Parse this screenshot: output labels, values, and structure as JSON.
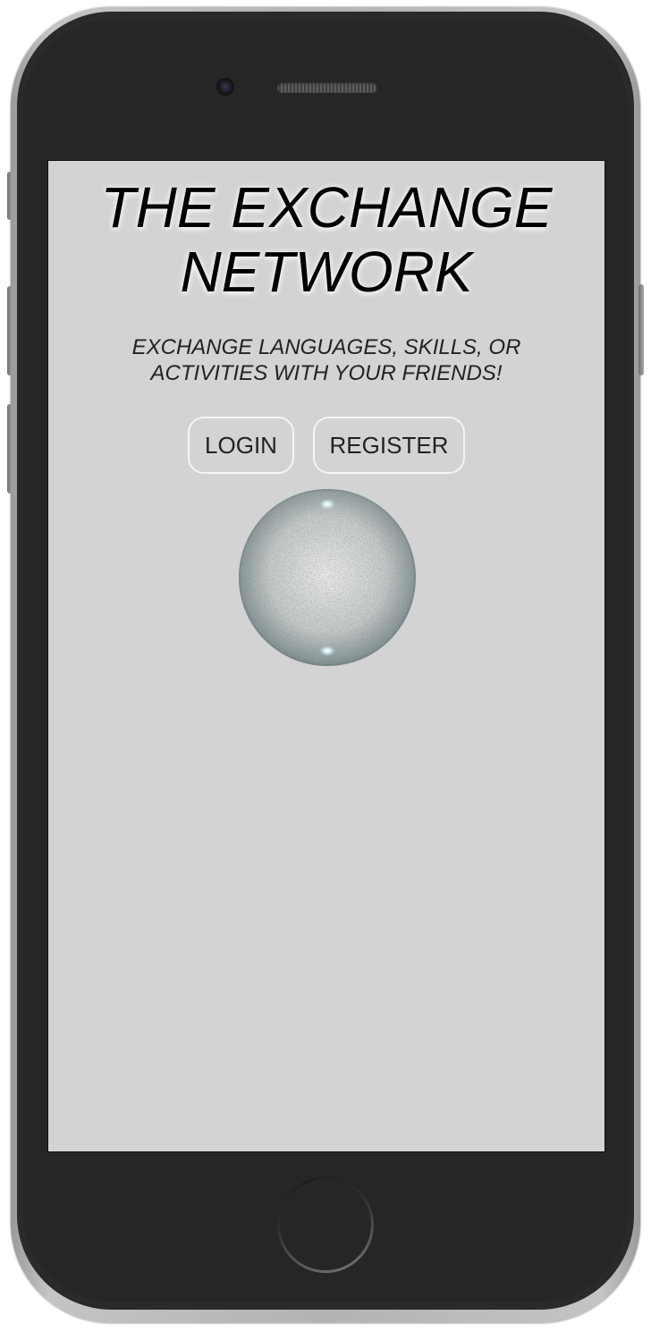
{
  "app": {
    "title_line1": "THE EXCHANGE",
    "title_line2": "NETWORK",
    "subtitle_line1": "EXCHANGE LANGUAGES, SKILLS, OR",
    "subtitle_line2": "ACTIVITIES WITH YOUR FRIENDS!"
  },
  "actions": {
    "login_label": "LOGIN",
    "register_label": "REGISTER"
  },
  "colors": {
    "screen_background": "#d3d3d3",
    "device_body": "#262626",
    "device_frame": "#b3b3b3",
    "button_border": "#f5f5f5",
    "text": "#000000"
  },
  "icons": {
    "orb": "sparkle-orb-icon",
    "camera": "front-camera-icon",
    "speaker": "earpiece-speaker-icon",
    "home": "home-button-icon"
  }
}
